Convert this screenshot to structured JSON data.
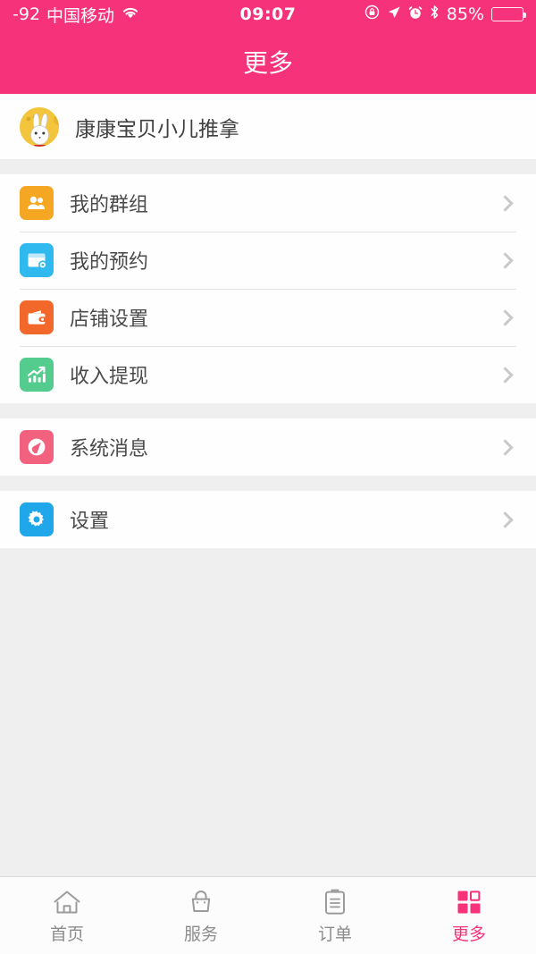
{
  "statusbar": {
    "signal": "-92",
    "carrier": "中国移动",
    "wifi_icon": "wifi-icon",
    "time": "09:07",
    "rotation_lock_icon": "rotation-lock-icon",
    "location_icon": "location-arrow-icon",
    "alarm_icon": "alarm-clock-icon",
    "bluetooth_icon": "bluetooth-icon",
    "battery_percent": "85%",
    "battery_level": 85
  },
  "navbar": {
    "title": "更多"
  },
  "profile": {
    "name": "康康宝贝小儿推拿",
    "avatar_icon": "rabbit-avatar",
    "avatar_bg": "#f2c53d"
  },
  "menu_groups": [
    {
      "items": [
        {
          "label": "我的群组",
          "icon": "group-icon",
          "color": "#f5a623",
          "chevron": "chevron-right-icon"
        },
        {
          "label": "我的预约",
          "icon": "booking-icon",
          "color": "#2fb9ef",
          "chevron": "chevron-right-icon"
        },
        {
          "label": "店铺设置",
          "icon": "wallet-icon",
          "color": "#f2672a",
          "chevron": "chevron-right-icon"
        },
        {
          "label": "收入提现",
          "icon": "chart-up-icon",
          "color": "#53cc8d",
          "chevron": "chevron-right-icon"
        }
      ]
    },
    {
      "items": [
        {
          "label": "系统消息",
          "icon": "bell-icon",
          "color": "#f2627e",
          "chevron": "chevron-right-icon"
        }
      ]
    },
    {
      "items": [
        {
          "label": "设置",
          "icon": "gear-icon",
          "color": "#1fa7ea",
          "chevron": "chevron-right-icon"
        }
      ]
    }
  ],
  "tabbar": {
    "active_color": "#f5327a",
    "inactive_color": "#8c8c8c",
    "tabs": [
      {
        "label": "首页",
        "icon": "home-icon",
        "active": false
      },
      {
        "label": "服务",
        "icon": "bag-icon",
        "active": false
      },
      {
        "label": "订单",
        "icon": "clipboard-icon",
        "active": false
      },
      {
        "label": "更多",
        "icon": "grid-icon",
        "active": true
      }
    ]
  },
  "theme": {
    "brand_pink": "#f5327a",
    "page_bg": "#efefef",
    "card_bg": "#fefefe"
  }
}
